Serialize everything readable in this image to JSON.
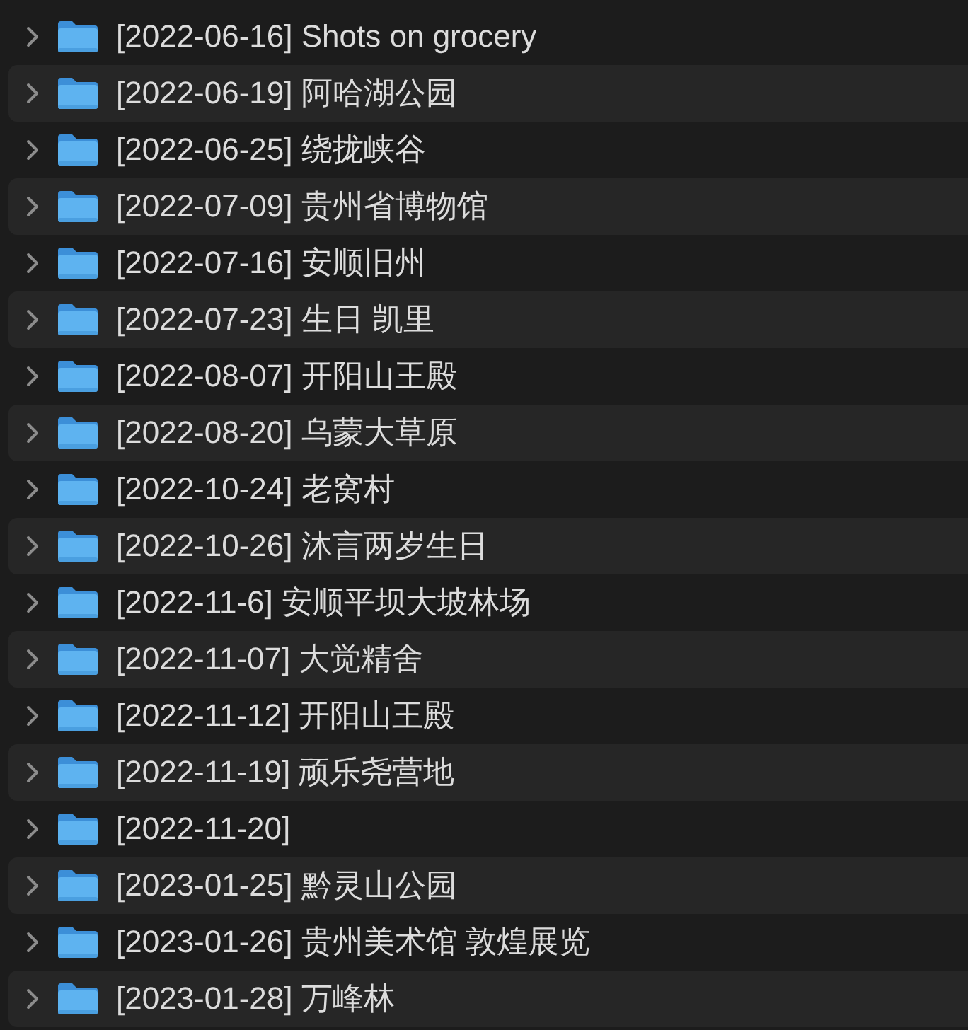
{
  "folders": [
    {
      "name": "[2022-06-16] Shots on grocery",
      "expanded": false
    },
    {
      "name": "[2022-06-19] 阿哈湖公园",
      "expanded": false
    },
    {
      "name": "[2022-06-25] 绕拢峡谷",
      "expanded": false
    },
    {
      "name": "[2022-07-09] 贵州省博物馆",
      "expanded": false
    },
    {
      "name": "[2022-07-16] 安顺旧州",
      "expanded": false
    },
    {
      "name": "[2022-07-23] 生日 凯里",
      "expanded": false
    },
    {
      "name": "[2022-08-07] 开阳山王殿",
      "expanded": false
    },
    {
      "name": "[2022-08-20] 乌蒙大草原",
      "expanded": false
    },
    {
      "name": "[2022-10-24] 老窝村",
      "expanded": false
    },
    {
      "name": "[2022-10-26] 沐言两岁生日",
      "expanded": false
    },
    {
      "name": "[2022-11-6] 安顺平坝大坡林场",
      "expanded": false
    },
    {
      "name": "[2022-11-07] 大觉精舍",
      "expanded": false
    },
    {
      "name": "[2022-11-12] 开阳山王殿",
      "expanded": false
    },
    {
      "name": "[2022-11-19] 顽乐尧营地",
      "expanded": false
    },
    {
      "name": "[2022-11-20]",
      "expanded": false
    },
    {
      "name": "[2023-01-25] 黔灵山公园",
      "expanded": false
    },
    {
      "name": "[2023-01-26] 贵州美术馆 敦煌展览",
      "expanded": false
    },
    {
      "name": "[2023-01-28] 万峰林",
      "expanded": false
    }
  ]
}
